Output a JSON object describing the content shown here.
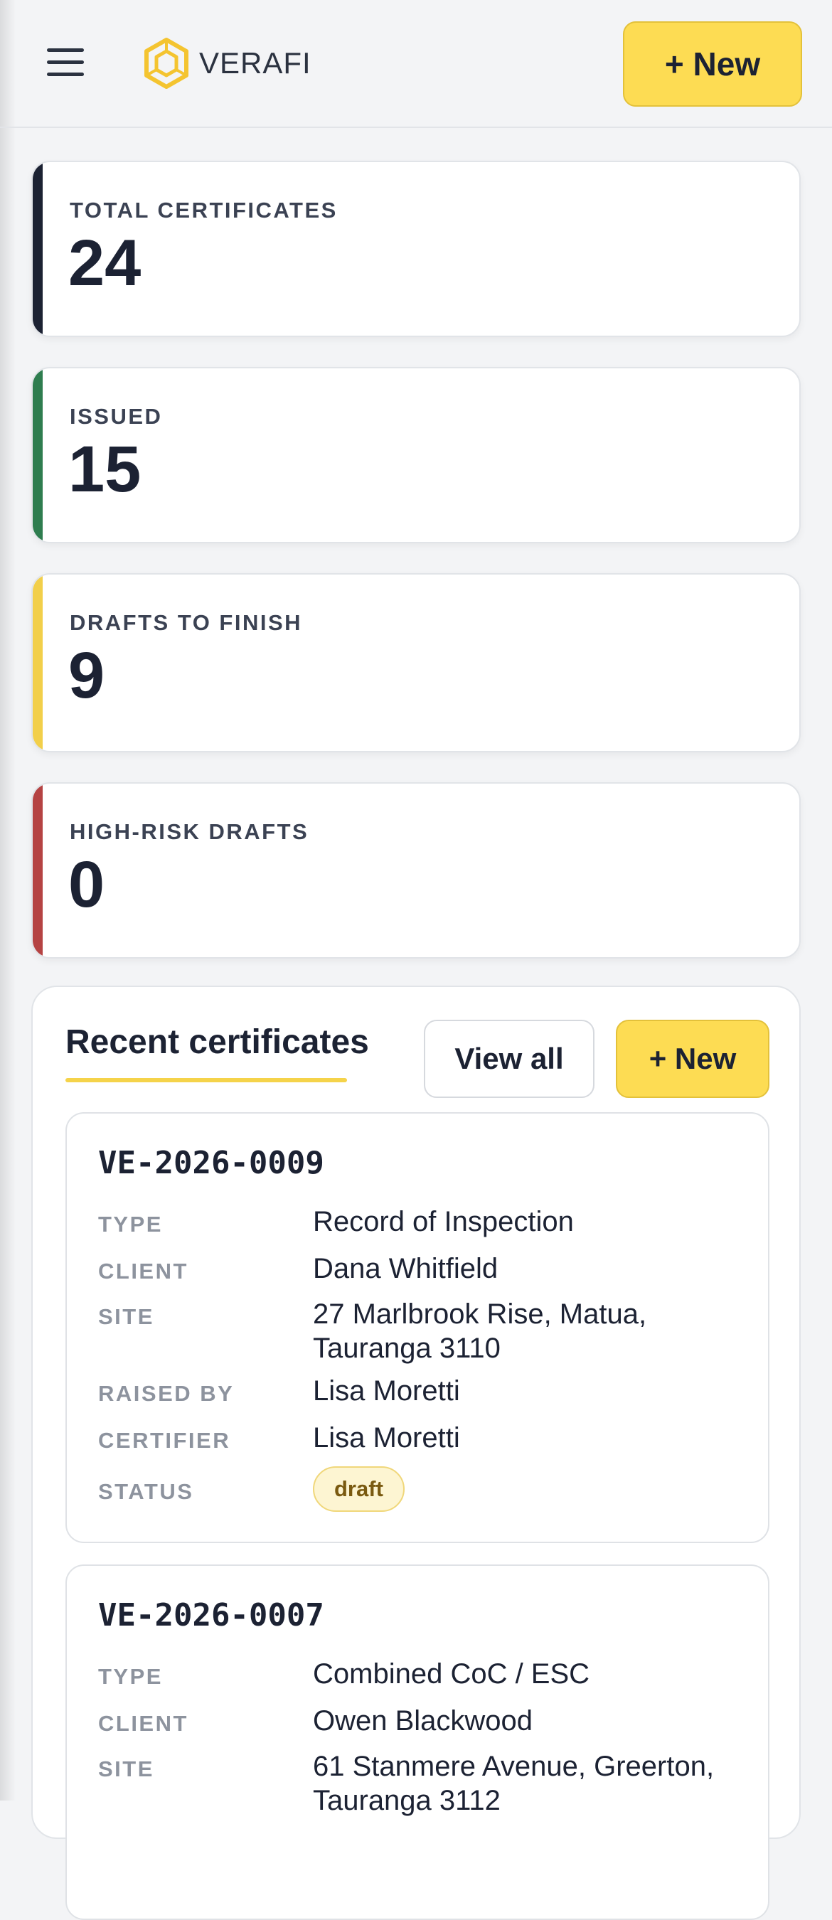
{
  "header": {
    "logo_text": "VERAFI",
    "new_button_label": "+ New",
    "brand_color": "#fddc53"
  },
  "stats": [
    {
      "label": "TOTAL CERTIFICATES",
      "value": "24",
      "accent": "#1c2233"
    },
    {
      "label": "ISSUED",
      "value": "15",
      "accent": "#2e7d4f"
    },
    {
      "label": "DRAFTS TO FINISH",
      "value": "9",
      "accent": "#f2cf4a"
    },
    {
      "label": "HIGH-RISK DRAFTS",
      "value": "0",
      "accent": "#b54343"
    }
  ],
  "recent": {
    "title": "Recent certificates",
    "view_all_label": "View all",
    "new_label": "+ New",
    "field_labels": {
      "type": "TYPE",
      "client": "CLIENT",
      "site": "SITE",
      "raised_by": "RAISED BY",
      "certifier": "CERTIFIER",
      "status": "STATUS"
    },
    "certificates": [
      {
        "id": "VE-2026-0009",
        "type": "Record of Inspection",
        "client": "Dana Whitfield",
        "site": "27 Marlbrook Rise, Matua, Tauranga 3110",
        "raised_by": "Lisa Moretti",
        "certifier": "Lisa Moretti",
        "status": "draft"
      },
      {
        "id": "VE-2026-0007",
        "type": "Combined CoC / ESC",
        "client": "Owen Blackwood",
        "site": "61 Stanmere Avenue, Greerton, Tauranga 3112"
      }
    ]
  },
  "icons": [
    "menu-icon",
    "verafi-logo-icon"
  ]
}
